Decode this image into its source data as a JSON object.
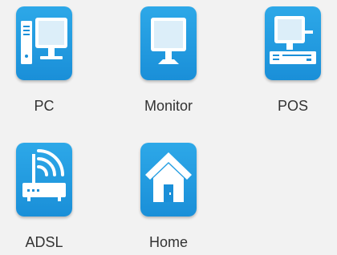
{
  "devices": [
    {
      "label": "PC",
      "icon": "pc-icon"
    },
    {
      "label": "Monitor",
      "icon": "monitor-icon"
    },
    {
      "label": "POS",
      "icon": "pos-icon"
    },
    {
      "label": "ADSL",
      "icon": "adsl-router-icon"
    },
    {
      "label": "Home",
      "icon": "home-icon"
    }
  ],
  "colors": {
    "tile_blue": "#1a8fd8",
    "tile_blue_light": "#2da8e8",
    "glyph_white": "#ffffff",
    "label_text": "#333333",
    "background": "#f2f2f2"
  }
}
